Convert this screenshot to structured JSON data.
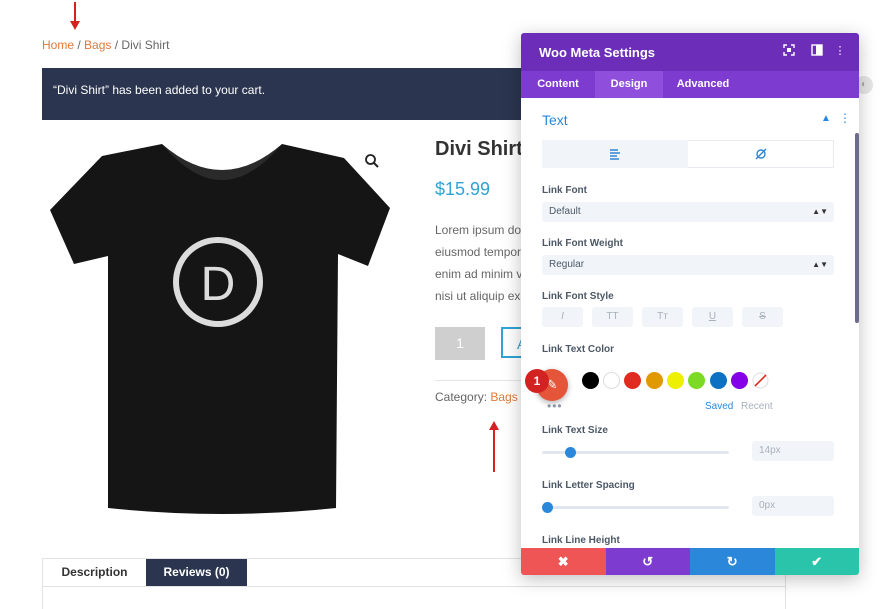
{
  "breadcrumb": {
    "home": "Home",
    "sep1": " / ",
    "bags": "Bags",
    "sep2": " / ",
    "current": "Divi Shirt"
  },
  "notice": {
    "text": "“Divi Shirt” has been added to your cart."
  },
  "product": {
    "title": "Divi Shirt",
    "price": "$15.99",
    "description_lines": [
      "Lorem ipsum dol",
      "eiusmod tempor",
      "enim ad minim v",
      "nisi ut aliquip ex"
    ],
    "quantity": "1",
    "add_to_cart_partial": "A",
    "category_label": "Category: ",
    "category_link": "Bags",
    "shirt_letter": "D"
  },
  "page_tabs": {
    "description": "Description",
    "reviews": "Reviews (0)"
  },
  "modal": {
    "title": "Woo Meta Settings",
    "tabs": [
      "Content",
      "Design",
      "Advanced"
    ],
    "active_tab": "Design",
    "section": "Text",
    "fields": {
      "link_font": {
        "label": "Link Font",
        "value": "Default"
      },
      "link_font_weight": {
        "label": "Link Font Weight",
        "value": "Regular"
      },
      "link_font_style": {
        "label": "Link Font Style",
        "buttons": [
          "I",
          "TT",
          "Tт",
          "U",
          "S"
        ]
      },
      "link_text_color": {
        "label": "Link Text Color",
        "saved": "Saved",
        "recent": "Recent",
        "marker": "1"
      },
      "link_text_size": {
        "label": "Link Text Size",
        "value": "14px",
        "level_percent": 15
      },
      "link_letter_spacing": {
        "label": "Link Letter Spacing",
        "value": "0px",
        "level_percent": 3
      },
      "link_line_height": {
        "label": "Link Line Height"
      }
    },
    "swatches": [
      "#000000",
      "#ffffff",
      "#e02b20",
      "#e09900",
      "#edf000",
      "#7cda24",
      "#0c71c3",
      "#8300e9"
    ],
    "footer_colors": {
      "discard": "#ef5555",
      "undo": "#7e3bd0",
      "redo": "#2b87da",
      "save": "#29c4a9"
    }
  },
  "colors": {
    "accent": "#e0783a",
    "notice_bg": "#2b3550",
    "price": "#2ea3d4",
    "modal_purple": "#6c2eb9"
  }
}
